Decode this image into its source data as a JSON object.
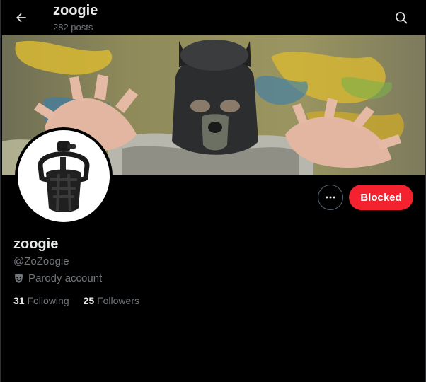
{
  "header": {
    "title": "zoogie",
    "posts_count": "282 posts",
    "back_icon": "arrow-left-icon",
    "search_icon": "search-icon"
  },
  "profile": {
    "display_name": "zoogie",
    "handle": "@ZoZoogie",
    "label": "Parody account",
    "label_icon": "masks-icon",
    "following_count": "31",
    "following_label": "Following",
    "followers_count": "25",
    "followers_label": "Followers"
  },
  "actions": {
    "more_icon": "more-icon",
    "blocked_label": "Blocked"
  },
  "colors": {
    "background": "#000000",
    "primary_text": "#e7e9ea",
    "secondary_text": "#71767b",
    "blocked_button": "#f4212e"
  }
}
